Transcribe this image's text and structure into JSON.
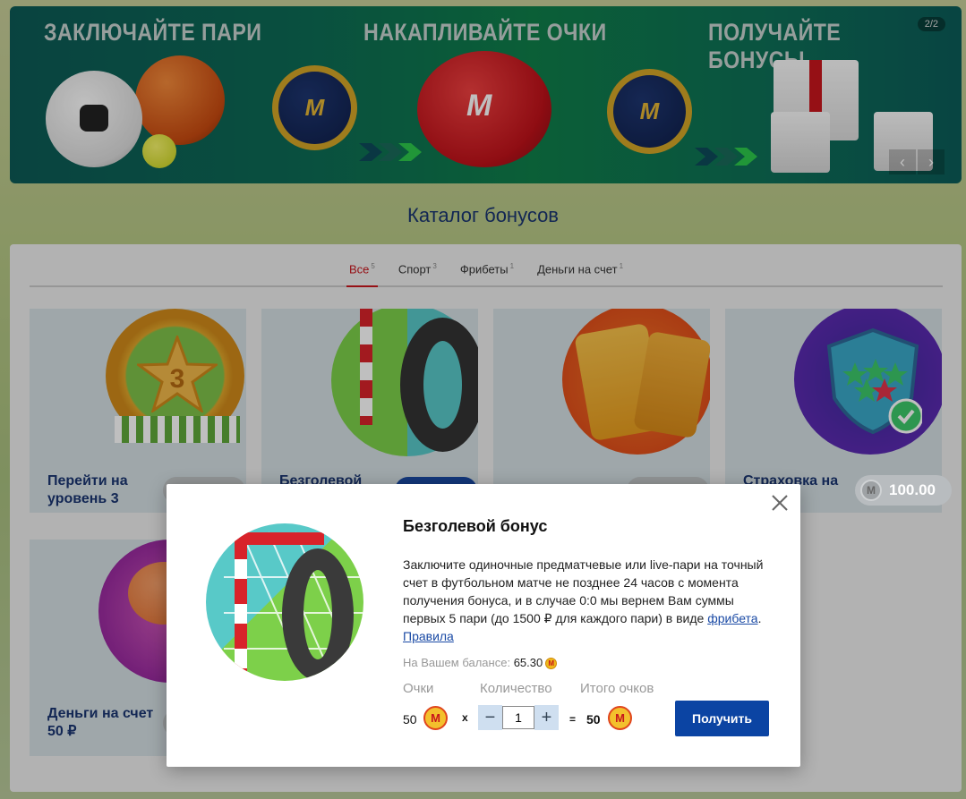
{
  "banner": {
    "titles": [
      "ЗАКЛЮЧАЙТЕ ПАРИ",
      "НАКАПЛИВАЙТЕ ОЧКИ",
      "ПОЛУЧАЙТЕ БОНУСЫ"
    ],
    "counter": "2/2",
    "coin_label": "M БЕТ",
    "prev_icon": "‹",
    "next_icon": "›"
  },
  "page": {
    "title": "Каталог бонусов"
  },
  "tabs": [
    {
      "label": "Все",
      "count": "5",
      "active": true
    },
    {
      "label": "Спорт",
      "count": "3"
    },
    {
      "label": "Фрибеты",
      "count": "1"
    },
    {
      "label": "Деньги на счет",
      "count": "1"
    }
  ],
  "cards": [
    {
      "title": "Перейти на уровень 3",
      "badge": "3"
    },
    {
      "title": "Безголевой"
    },
    {
      "title": ""
    },
    {
      "title": "Страховка на «Экспресс»",
      "title_visible": "Страховка на\nсс»",
      "price": "100.00"
    },
    {
      "title": "Деньги на счет 50 ₽"
    }
  ],
  "modal": {
    "title": "Безголевой бонус",
    "description_part1": "Заключите одиночные предматчевые или live-пари на точный счет в футбольном матче не позднее 24 часов с момента получения бонуса, и в случае 0:0 мы вернем Вам суммы первых 5 пари (до 1500 ₽ для каждого пари) в виде ",
    "freebet_link": "фрибета",
    "dot": ".",
    "rules_link": "Правила",
    "balance_label": "На Вашем балансе:",
    "balance_value": "65.30",
    "points_label": "Очки",
    "quantity_label": "Количество",
    "total_label": "Итого очков",
    "points_value": "50",
    "multiply": "x",
    "quantity_value": "1",
    "equals": "=",
    "total_value": "50",
    "coin_letter": "M",
    "get_button": "Получить",
    "minus": "−",
    "plus": "+"
  },
  "colors": {
    "accent": "#c8161d",
    "brand_blue": "#0b44a3",
    "title_blue": "#1a3570"
  }
}
